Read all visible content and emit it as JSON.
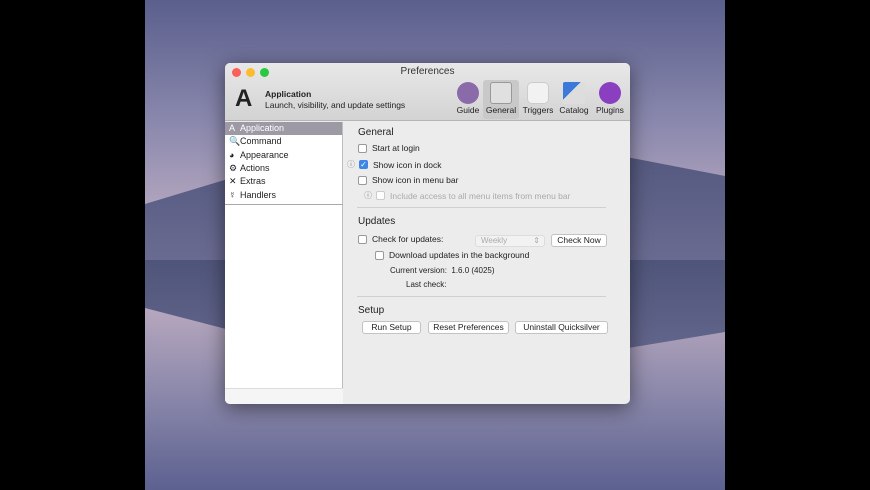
{
  "window": {
    "title": "Preferences"
  },
  "header": {
    "title": "Application",
    "subtitle": "Launch, visibility, and update settings"
  },
  "toolbar": [
    {
      "label": "Guide"
    },
    {
      "label": "General"
    },
    {
      "label": "Triggers"
    },
    {
      "label": "Catalog"
    },
    {
      "label": "Plugins"
    }
  ],
  "sidebar": {
    "items": [
      {
        "label": "Application",
        "icon": "A"
      },
      {
        "label": "Command",
        "icon": "🔍"
      },
      {
        "label": "Appearance",
        "icon": "◕"
      },
      {
        "label": "Actions",
        "icon": "⚙"
      },
      {
        "label": "Extras",
        "icon": "✕"
      },
      {
        "label": "Handlers",
        "icon": "☿"
      }
    ]
  },
  "general": {
    "heading": "General",
    "start_at_login": "Start at login",
    "show_dock": "Show icon in dock",
    "show_menubar": "Show icon in menu bar",
    "include_menu": "Include access to all menu items from menu bar"
  },
  "updates": {
    "heading": "Updates",
    "check": "Check for updates:",
    "frequency": "Weekly",
    "check_now": "Check Now",
    "download": "Download updates in the background",
    "current_label": "Current version:",
    "current_value": "1.6.0 (4025)",
    "last_label": "Last check:"
  },
  "setup": {
    "heading": "Setup",
    "run": "Run Setup",
    "reset": "Reset Preferences",
    "uninstall": "Uninstall Quicksilver"
  }
}
